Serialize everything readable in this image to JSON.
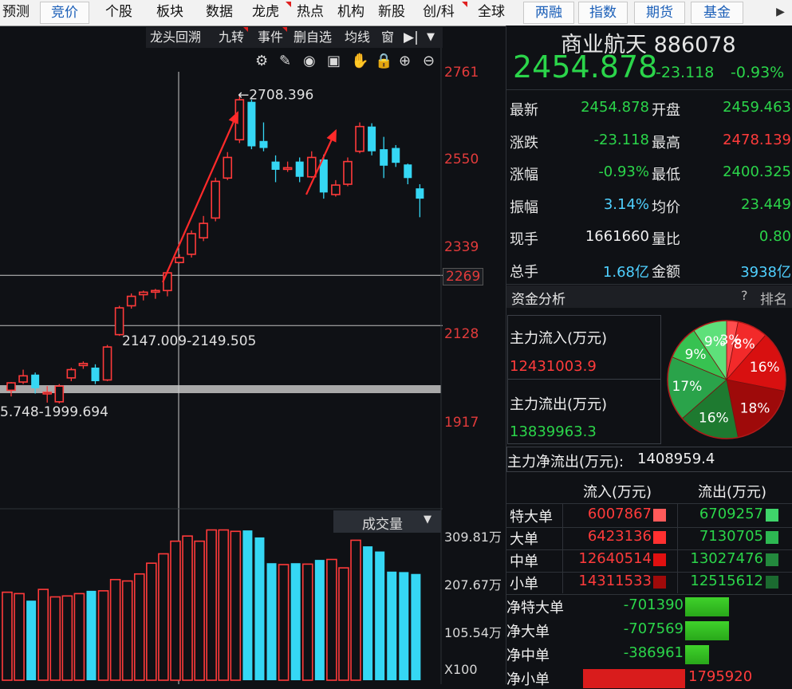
{
  "top_nav": {
    "items": [
      {
        "label": "预测",
        "boxed": false,
        "corner": false
      },
      {
        "label": "竞价",
        "boxed": true,
        "corner": false
      },
      {
        "label": "个股",
        "boxed": false,
        "corner": false
      },
      {
        "label": "板块",
        "boxed": false,
        "corner": false
      },
      {
        "label": "数据",
        "boxed": false,
        "corner": false
      },
      {
        "label": "龙虎",
        "boxed": false,
        "corner": true
      },
      {
        "label": "热点",
        "boxed": false,
        "corner": false
      },
      {
        "label": "机构",
        "boxed": false,
        "corner": false
      },
      {
        "label": "新股",
        "boxed": false,
        "corner": false
      },
      {
        "label": "创/科",
        "boxed": false,
        "corner": true
      },
      {
        "label": "全球",
        "boxed": false,
        "corner": false
      },
      {
        "label": "两融",
        "boxed": true,
        "corner": false
      },
      {
        "label": "指数",
        "boxed": true,
        "corner": false
      },
      {
        "label": "期货",
        "boxed": true,
        "corner": false
      },
      {
        "label": "基金",
        "boxed": true,
        "corner": false
      }
    ]
  },
  "toolbar": {
    "items": [
      "龙头回溯",
      "九转",
      "事件",
      "删自选",
      "均线",
      "窗"
    ],
    "corners": [
      false,
      true,
      true,
      false,
      false,
      false
    ],
    "expand_icon": "pin-right-icon",
    "menu_icon": "dropdown-arrow-icon"
  },
  "chart_tools": [
    "gear-icon",
    "brush-icon",
    "eye-icon",
    "gift-icon",
    "hand-icon",
    "lock-icon",
    "zoom-in-icon",
    "zoom-out-icon"
  ],
  "chart_data": {
    "type": "candlestick",
    "price_axis_ticks": [
      "2761",
      "2550",
      "2339",
      "2269",
      "2128",
      "1917"
    ],
    "current_tick": "2269",
    "annotations": {
      "high": "2708.396",
      "range_1": "2147.009-2149.505",
      "range_2": "5.748-1999.694"
    },
    "candles": [
      {
        "o": 1990,
        "h": 2010,
        "l": 1975,
        "c": 2008
      },
      {
        "o": 2010,
        "h": 2040,
        "l": 2005,
        "c": 2025
      },
      {
        "o": 2028,
        "h": 2033,
        "l": 1982,
        "c": 1995
      },
      {
        "o": 1985,
        "h": 2000,
        "l": 1960,
        "c": 1985
      },
      {
        "o": 1962,
        "h": 2005,
        "l": 1958,
        "c": 2000
      },
      {
        "o": 2020,
        "h": 2045,
        "l": 2012,
        "c": 2040
      },
      {
        "o": 2050,
        "h": 2060,
        "l": 2042,
        "c": 2055
      },
      {
        "o": 2045,
        "h": 2053,
        "l": 2005,
        "c": 2012
      },
      {
        "o": 2015,
        "h": 2100,
        "l": 2012,
        "c": 2095
      },
      {
        "o": 2125,
        "h": 2195,
        "l": 2122,
        "c": 2190
      },
      {
        "o": 2195,
        "h": 2225,
        "l": 2188,
        "c": 2218
      },
      {
        "o": 2222,
        "h": 2232,
        "l": 2208,
        "c": 2228
      },
      {
        "o": 2230,
        "h": 2236,
        "l": 2212,
        "c": 2232
      },
      {
        "o": 2232,
        "h": 2282,
        "l": 2218,
        "c": 2275
      },
      {
        "o": 2300,
        "h": 2320,
        "l": 2298,
        "c": 2312
      },
      {
        "o": 2320,
        "h": 2378,
        "l": 2312,
        "c": 2370
      },
      {
        "o": 2360,
        "h": 2413,
        "l": 2352,
        "c": 2395
      },
      {
        "o": 2408,
        "h": 2506,
        "l": 2400,
        "c": 2497
      },
      {
        "o": 2505,
        "h": 2568,
        "l": 2500,
        "c": 2555
      },
      {
        "o": 2598,
        "h": 2708,
        "l": 2590,
        "c": 2695
      },
      {
        "o": 2690,
        "h": 2695,
        "l": 2575,
        "c": 2582
      },
      {
        "o": 2595,
        "h": 2640,
        "l": 2570,
        "c": 2578
      },
      {
        "o": 2545,
        "h": 2560,
        "l": 2495,
        "c": 2525
      },
      {
        "o": 2530,
        "h": 2545,
        "l": 2520,
        "c": 2530
      },
      {
        "o": 2545,
        "h": 2555,
        "l": 2495,
        "c": 2508
      },
      {
        "o": 2508,
        "h": 2570,
        "l": 2505,
        "c": 2555
      },
      {
        "o": 2550,
        "h": 2562,
        "l": 2455,
        "c": 2470
      },
      {
        "o": 2465,
        "h": 2500,
        "l": 2460,
        "c": 2488
      },
      {
        "o": 2490,
        "h": 2555,
        "l": 2485,
        "c": 2545
      },
      {
        "o": 2570,
        "h": 2640,
        "l": 2565,
        "c": 2630
      },
      {
        "o": 2630,
        "h": 2638,
        "l": 2560,
        "c": 2570
      },
      {
        "o": 2575,
        "h": 2605,
        "l": 2505,
        "c": 2535
      },
      {
        "o": 2578,
        "h": 2585,
        "l": 2532,
        "c": 2542
      },
      {
        "o": 2538,
        "h": 2540,
        "l": 2490,
        "c": 2505
      },
      {
        "o": 2480,
        "h": 2490,
        "l": 2410,
        "c": 2455
      }
    ],
    "volume_axis_ticks": [
      "309.81万",
      "207.67万",
      "105.54万",
      "X100"
    ],
    "volume_label": "成交量",
    "volumes": [
      188,
      185,
      170,
      194,
      178,
      180,
      185,
      191,
      191,
      215,
      212,
      227,
      250,
      270,
      297,
      308,
      297,
      321,
      321,
      318,
      320,
      305,
      250,
      247,
      250,
      248,
      257,
      258,
      240,
      299,
      286,
      275,
      232,
      231,
      227
    ]
  },
  "quote": {
    "name": "商业航天 886078",
    "price": "2454.878",
    "change": "-23.118",
    "change_pct": "-0.93%",
    "rows": [
      {
        "l1": "最新",
        "v1": "2454.878",
        "c1": "green",
        "l2": "开盘",
        "v2": "2459.463",
        "c2": "green"
      },
      {
        "l1": "涨跌",
        "v1": "-23.118",
        "c1": "green",
        "l2": "最高",
        "v2": "2478.139",
        "c2": "red"
      },
      {
        "l1": "涨幅",
        "v1": "-0.93%",
        "c1": "green",
        "l2": "最低",
        "v2": "2400.325",
        "c2": "green"
      },
      {
        "l1": "振幅",
        "v1": "3.14%",
        "c1": "cyan",
        "l2": "均价",
        "v2": "23.449",
        "c2": "green"
      },
      {
        "l1": "现手",
        "v1": "1661660",
        "c1": "white",
        "l2": "量比",
        "v2": "0.80",
        "c2": "green"
      },
      {
        "l1": "总手",
        "v1": "1.68亿",
        "c1": "cyan",
        "l2": "金额",
        "v2": "3938亿",
        "c2": "cyan"
      }
    ]
  },
  "fund": {
    "title": "资金分析",
    "help": "?",
    "rank": "排名",
    "inflow_label": "主力流入(万元)",
    "inflow_value": "12431003.9",
    "outflow_label": "主力流出(万元)",
    "outflow_value": "13839963.3",
    "net_label": "主力净流出(万元):",
    "net_value": "1408959.4",
    "pie": [
      {
        "label": "3%",
        "value": 3,
        "color": "#ff4d4d"
      },
      {
        "label": "8%",
        "value": 8,
        "color": "#f22a2a"
      },
      {
        "label": "16%",
        "value": 16,
        "color": "#d81010"
      },
      {
        "label": "18%",
        "value": 18,
        "color": "#9e0a0a"
      },
      {
        "label": "16%",
        "value": 16,
        "color": "#1e7a30"
      },
      {
        "label": "17%",
        "value": 17,
        "color": "#2aa34a"
      },
      {
        "label": "9%",
        "value": 9,
        "color": "#37c251"
      },
      {
        "label": "9%",
        "value": 9,
        "color": "#5ee07a"
      }
    ],
    "flow_header_in": "流入(万元)",
    "flow_header_out": "流出(万元)",
    "flow_rows": [
      {
        "label": "特大单",
        "in": "6007867",
        "out": "6709257",
        "cin": "#ff5a5a",
        "cout": "#3fd46a"
      },
      {
        "label": "大单",
        "in": "6423136",
        "out": "7130705",
        "cin": "#ff3030",
        "cout": "#2db852"
      },
      {
        "label": "中单",
        "in": "12640514",
        "out": "13027476",
        "cin": "#e01010",
        "cout": "#23893d"
      },
      {
        "label": "小单",
        "in": "14311533",
        "out": "12515612",
        "cin": "#a00a0a",
        "cout": "#1b6a30"
      }
    ],
    "net_rows": [
      {
        "label": "净特大单",
        "value": "-701390",
        "color": "green",
        "bar": 0.55
      },
      {
        "label": "净大单",
        "value": "-707569",
        "color": "green",
        "bar": 0.55
      },
      {
        "label": "净中单",
        "value": "-386961",
        "color": "green",
        "bar": 0.3
      },
      {
        "label": "净小单",
        "value": "1795920",
        "color": "red",
        "bar": 1.0
      }
    ]
  }
}
